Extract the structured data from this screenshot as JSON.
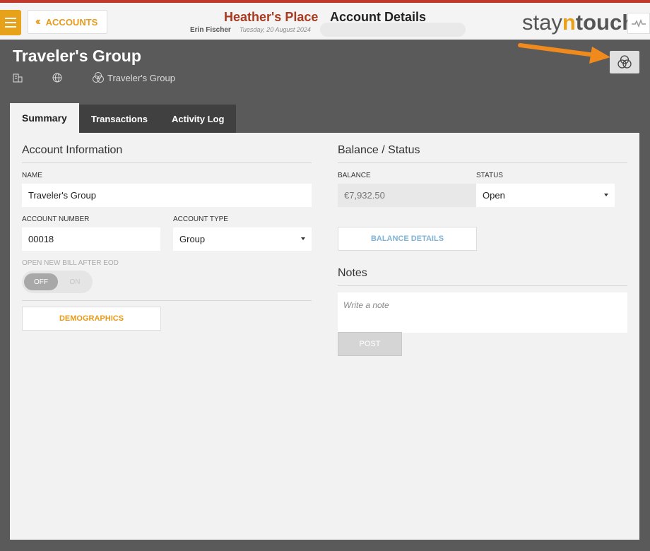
{
  "header": {
    "back_label": "ACCOUNTS",
    "hotel_name": "Heather's Place",
    "page_title": "Account Details",
    "user_name": "Erin Fischer",
    "date": "Tuesday, 20 August 2024",
    "logo_pre": "stay",
    "logo_n": "n",
    "logo_post": "touch"
  },
  "account_header": {
    "name": "Traveler's Group",
    "group_link": "Traveler's Group"
  },
  "tabs": [
    {
      "label": "Summary",
      "active": true
    },
    {
      "label": "Transactions",
      "active": false
    },
    {
      "label": "Activity Log",
      "active": false
    }
  ],
  "account_info": {
    "title": "Account Information",
    "name_label": "NAME",
    "name_value": "Traveler's Group",
    "number_label": "ACCOUNT NUMBER",
    "number_value": "00018",
    "type_label": "ACCOUNT TYPE",
    "type_value": "Group",
    "bill_label": "OPEN NEW BILL AFTER EOD",
    "toggle_off": "OFF",
    "toggle_on": "ON",
    "demographics_label": "DEMOGRAPHICS"
  },
  "balance_status": {
    "title": "Balance / Status",
    "balance_label": "BALANCE",
    "balance_value": "€7,932.50",
    "status_label": "STATUS",
    "status_value": "Open",
    "details_label": "BALANCE DETAILS"
  },
  "notes": {
    "title": "Notes",
    "placeholder": "Write a note",
    "post_label": "POST"
  },
  "colors": {
    "accent": "#e8a21a",
    "hotel": "#a83a1f",
    "top_border": "#c0392b",
    "annotation_arrow": "#f08a1c"
  }
}
